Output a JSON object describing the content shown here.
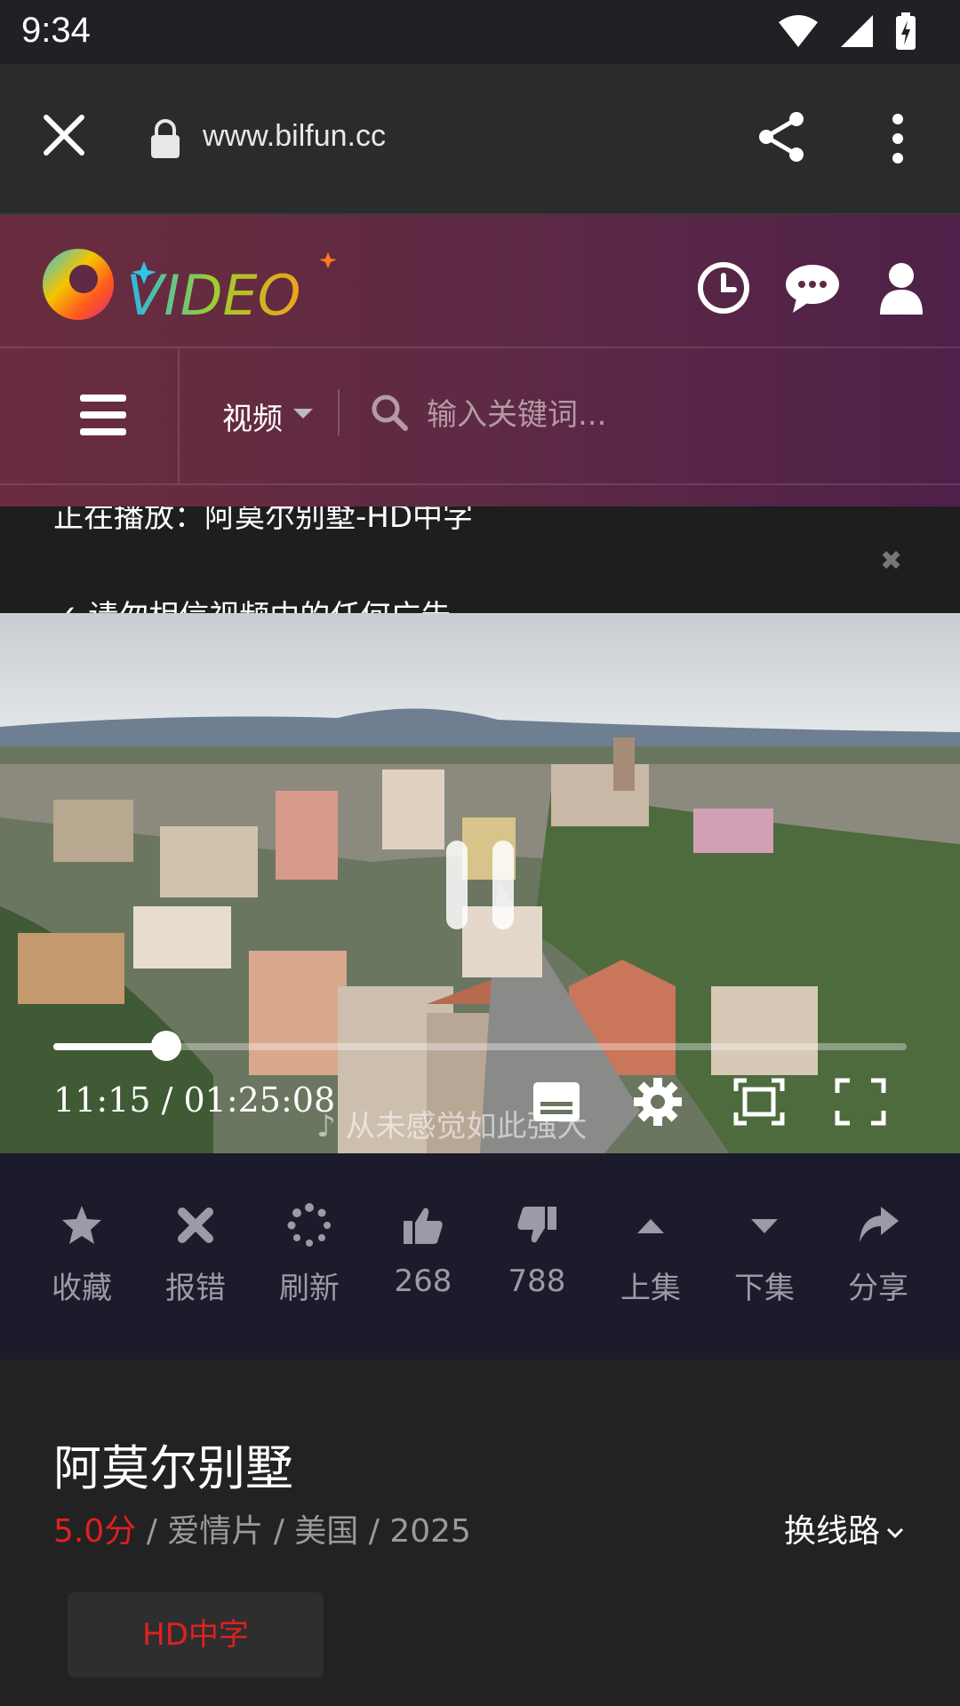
{
  "status_bar": {
    "time": "9:34"
  },
  "browser": {
    "url": "www.bilfun.cc"
  },
  "site": {
    "logo_text": "VIDEO",
    "category_label": "视频",
    "search_placeholder": "输入关键词..."
  },
  "notice": {
    "now_playing": "正在播放：阿莫尔别墅-HD中字",
    "warning": "✓ 请勿相信视频中的任何广告",
    "close_glyph": "✖"
  },
  "player": {
    "current_time": "11:15",
    "duration": "01:25:08",
    "time_display": "11:15 / 01:25:08",
    "progress_fraction": 0.132,
    "lyric_overlay": "♪ 从未感觉如此强大"
  },
  "actions": [
    {
      "icon": "star-icon",
      "label": "收藏"
    },
    {
      "icon": "close-icon",
      "label": "报错"
    },
    {
      "icon": "spinner-icon",
      "label": "刷新"
    },
    {
      "icon": "thumbs-up-icon",
      "label": "268"
    },
    {
      "icon": "thumbs-down-icon",
      "label": "788"
    },
    {
      "icon": "caret-up-icon",
      "label": "上集"
    },
    {
      "icon": "caret-down-icon",
      "label": "下集"
    },
    {
      "icon": "share-icon",
      "label": "分享"
    }
  ],
  "movie": {
    "title": "阿莫尔别墅",
    "score": "5.0分",
    "meta_rest": " / 爱情片 / 美国 / 2025",
    "switch_route": "换线路",
    "quality_badge": "HD中字"
  },
  "colors": {
    "accent_red": "#e02020",
    "header_start": "#6a2c3e",
    "header_end": "#4f2049",
    "action_bar": "#1b1b2b"
  }
}
